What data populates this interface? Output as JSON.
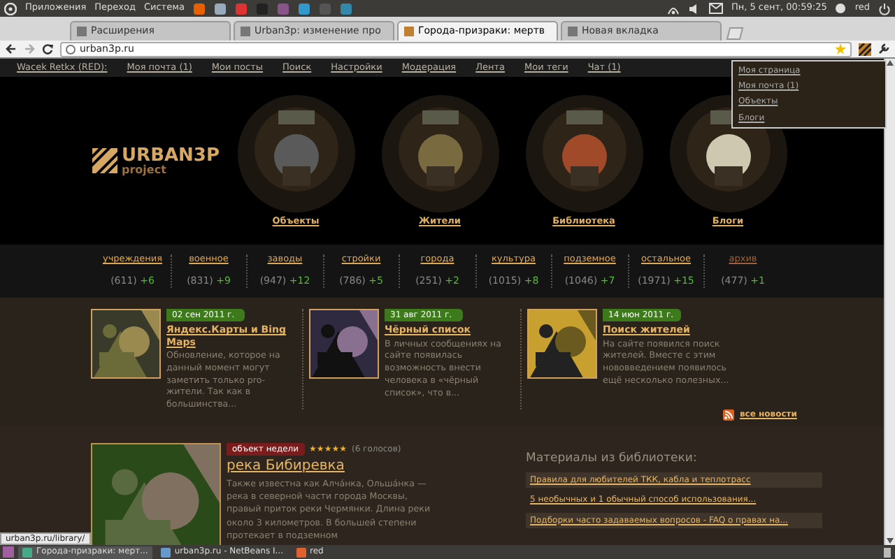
{
  "os_panel": {
    "menus": [
      "Приложения",
      "Переход",
      "Система"
    ],
    "clock": "Пн, 5 сент, 00:59:25",
    "user": "red"
  },
  "browser": {
    "tabs": [
      {
        "label": "Расширения",
        "selected": false
      },
      {
        "label": "Urban3p: изменение про",
        "selected": false
      },
      {
        "label": "Города-призраки: мертв",
        "selected": true
      },
      {
        "label": "Новая вкладка",
        "selected": false
      }
    ],
    "url": "urban3p.ru"
  },
  "site_nav": {
    "user": "Wacek Retkx (RED):",
    "links": [
      "Моя почта (1)",
      "Мои посты",
      "Поиск",
      "Настройки",
      "Модерация",
      "Лента",
      "Мои теги",
      "Чат (1)"
    ]
  },
  "dropdown": [
    "Моя страница",
    "Моя почта (1)",
    "Объекты",
    "Блоги"
  ],
  "header": {
    "logo": "URBAN3P",
    "logo_sub": "project",
    "sections": [
      "Объекты",
      "Жители",
      "Библиотека",
      "Блоги"
    ]
  },
  "categories": [
    {
      "label": "учреждения",
      "count": "(611)",
      "new": "+6",
      "kind": "category"
    },
    {
      "label": "военное",
      "count": "(831)",
      "new": "+9",
      "kind": "category"
    },
    {
      "label": "заводы",
      "count": "(947)",
      "new": "+12",
      "kind": "category"
    },
    {
      "label": "стройки",
      "count": "(786)",
      "new": "+5",
      "kind": "category"
    },
    {
      "label": "города",
      "count": "(251)",
      "new": "+2",
      "kind": "category"
    },
    {
      "label": "культура",
      "count": "(1015)",
      "new": "+8",
      "kind": "category"
    },
    {
      "label": "подземное",
      "count": "(1046)",
      "new": "+7",
      "kind": "category"
    },
    {
      "label": "остальное",
      "count": "(1971)",
      "new": "+15",
      "kind": "category"
    },
    {
      "label": "архив",
      "count": "(477)",
      "new": "+1",
      "kind": "archive"
    }
  ],
  "news": [
    {
      "date": "02 сен 2011 г.",
      "title": "Яндекс.Карты и Bing Maps",
      "text": "Обновление, которое на данный момент могут заметить только pro-жители. Так как в большинства..."
    },
    {
      "date": "31 авг 2011 г.",
      "title": "Чёрный список",
      "text": "В личных сообщениях на сайте появилась возможность внести человека в «чёрный список», что в..."
    },
    {
      "date": "14 июн 2011 г.",
      "title": "Поиск жителей",
      "text": "На сайте появился поиск жителей. Вместе с этим нововведением появилось ещё несколько полезных..."
    }
  ],
  "all_news": "все новости",
  "feature": {
    "badge": "объект недели",
    "stars": 5,
    "votes": "(6 голосов)",
    "title": "река Бибиревка",
    "text": "Также известна как Алча́нка, Ольша́нка — река в северной части города Москвы, правый приток реки Чермянки. Длина реки около 3 километров. В большей степени протекает в подземном"
  },
  "library": {
    "title": "Материалы из библиотеки:",
    "links": [
      "Правила для любителей ТКК, кабла и теплотрасс",
      "5 необычных и 1 обычный способ использования...",
      "Подборки часто задаваемых вопросов - FAQ о правах на..."
    ]
  },
  "status_url": "urban3p.ru/library/",
  "taskbar": [
    "Города-призраки: мерт...",
    "urban3p.ru - NetBeans I...",
    "red"
  ]
}
